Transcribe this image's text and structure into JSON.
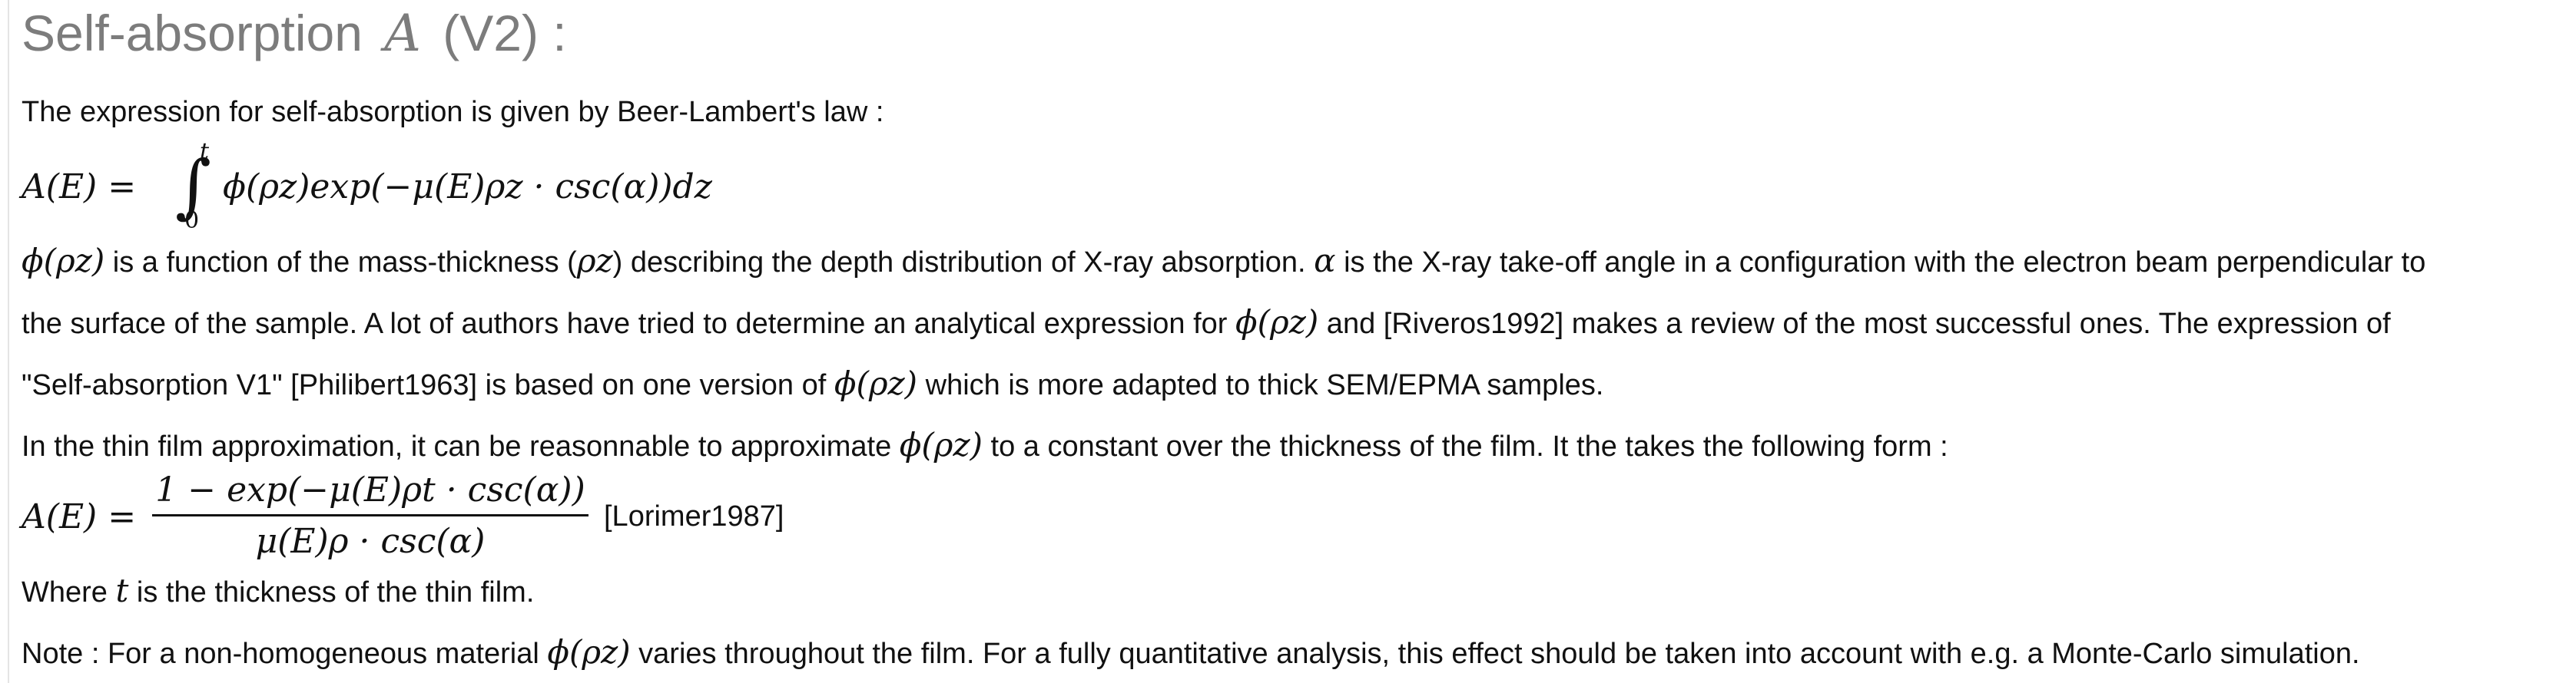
{
  "heading": {
    "prefix": "Self-absorption",
    "symbol": "A",
    "suffix": "(V2) :"
  },
  "intro": "The expression for self-absorption is given by Beer-Lambert's law :",
  "equation1": {
    "lhs": "A(E) =",
    "integral_sign": "∫",
    "upper_bound": "t",
    "lower_bound": "0",
    "integrand": "ϕ(ρz)exp(−μ(E)ρz · csc(α))dz"
  },
  "para1": {
    "phi": "ϕ(ρz)",
    "text1": " is a function of the mass-thickness (",
    "rhoz": "ρz",
    "text2": ") describing the depth distribution of X-ray absorption. ",
    "alpha": "α",
    "text3": " is the X-ray take-off angle in a configuration with the electron beam perpendicular to"
  },
  "para2": {
    "text1": "the surface of the sample. A lot of authors have tried to determine an analytical expression for ",
    "phi": "ϕ(ρz)",
    "text2": " and [Riveros1992] makes a review of the most successful ones. The expression of"
  },
  "para3": {
    "text1": "\"Self-absorption V1\" [Philibert1963] is based on one version of ",
    "phi": "ϕ(ρz)",
    "text2": " which is more adapted to thick SEM/EPMA samples."
  },
  "para4": {
    "text1": "In the thin film approximation, it can be reasonnable to approximate ",
    "phi": "ϕ(ρz)",
    "text2": " to a constant over the thickness of the film. It the takes the following form :"
  },
  "equation2": {
    "lhs": "A(E) =",
    "numerator": "1 − exp(−μ(E)ρt · csc(α))",
    "denominator": "μ(E)ρ · csc(α)",
    "citation": "[Lorimer1987]"
  },
  "para5": {
    "text1": "Where ",
    "t": "t",
    "text2": " is the thickness of the thin film."
  },
  "para6": {
    "text1": "Note : For a non-homogeneous material ",
    "phi": "ϕ(ρz)",
    "text2": " varies throughout the film. For a fully quantitative analysis, this effect should be taken into account with e.g. a Monte-Carlo simulation."
  }
}
